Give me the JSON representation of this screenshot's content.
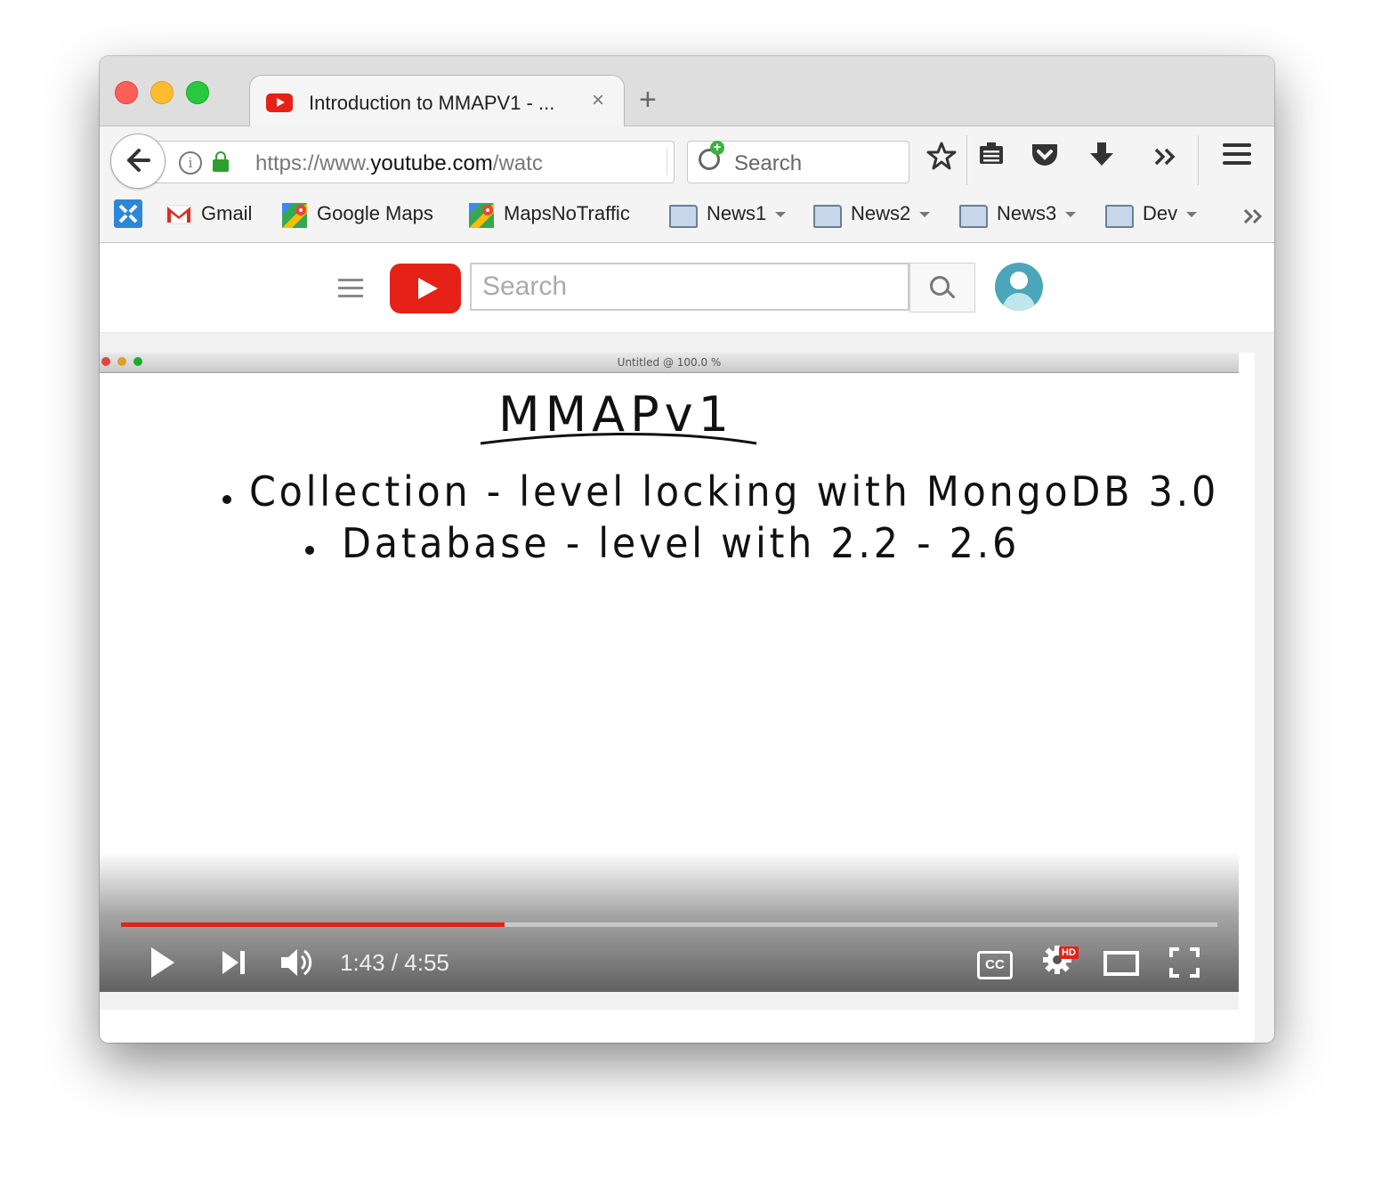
{
  "browser": {
    "tab": {
      "title": "Introduction to MMAPV1 - ...",
      "close_glyph": "×"
    },
    "new_tab_glyph": "+",
    "url": {
      "prefix": "https://www.",
      "domain": "youtube.com",
      "suffix": "/watc"
    },
    "search_placeholder": "Search",
    "bookmarks": [
      {
        "label": "Gmail"
      },
      {
        "label": "Google Maps"
      },
      {
        "label": "MapsNoTraffic"
      },
      {
        "label": "News1"
      },
      {
        "label": "News2"
      },
      {
        "label": "News3"
      },
      {
        "label": "Dev"
      }
    ]
  },
  "youtube": {
    "search_placeholder": "Search"
  },
  "video": {
    "window_title": "Untitled @ 100.0 %",
    "heading": "MMAPv1",
    "bullets": [
      "Collection - level locking with MongoDB 3.0",
      "Database - level with 2.2 - 2.6"
    ],
    "time": "1:43 / 4:55",
    "progress_fraction": 0.35,
    "hd_label": "HD",
    "cc_label": "CC"
  }
}
